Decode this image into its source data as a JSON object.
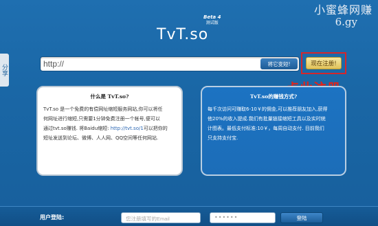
{
  "watermark": {
    "line1": "小蜜蜂网赚",
    "line2": "6.gy"
  },
  "header": {
    "logo": "TvT.so",
    "beta_label": "Beta 4",
    "beta_sub": "测试版"
  },
  "share_tab": {
    "label": "分享"
  },
  "url_bar": {
    "value": "http://",
    "shorten_label": "将它变短!"
  },
  "register": {
    "label": "现在注册!"
  },
  "annotation": {
    "text": "点此注册"
  },
  "about": {
    "title": "什么是  TvT.so?",
    "lines": [
      "TvT.so 是一个免费的有偿网址缩短服务网站,你可以将任",
      "何网址进行缩短,只需要1分钟免费注册一个帐号,便可以",
      "通过tvt.so赚钱. 将Baidu缩短: ",
      "短址发送到论坛、微博、人人网、QQ空间等任何网站."
    ],
    "link_text": "http://tvt.so/1",
    "link_suffix": "可以把你的"
  },
  "earn": {
    "title": "TvT.so的赚钱方式?",
    "lines": [
      "每千次访问可赚取6-10￥的佣金,可以推荐朋友加入,获得",
      "他20%的收入提成.我们有批量链接缩短工具以及实时统",
      "计图表。最低支付标准:10￥，每周自动支付. 目前我们",
      "只支持支付宝."
    ]
  },
  "login": {
    "label": "用户登陆:",
    "email_placeholder": "您注册填写的Email",
    "password_mask": "••••••",
    "button_label": "登陆"
  }
}
